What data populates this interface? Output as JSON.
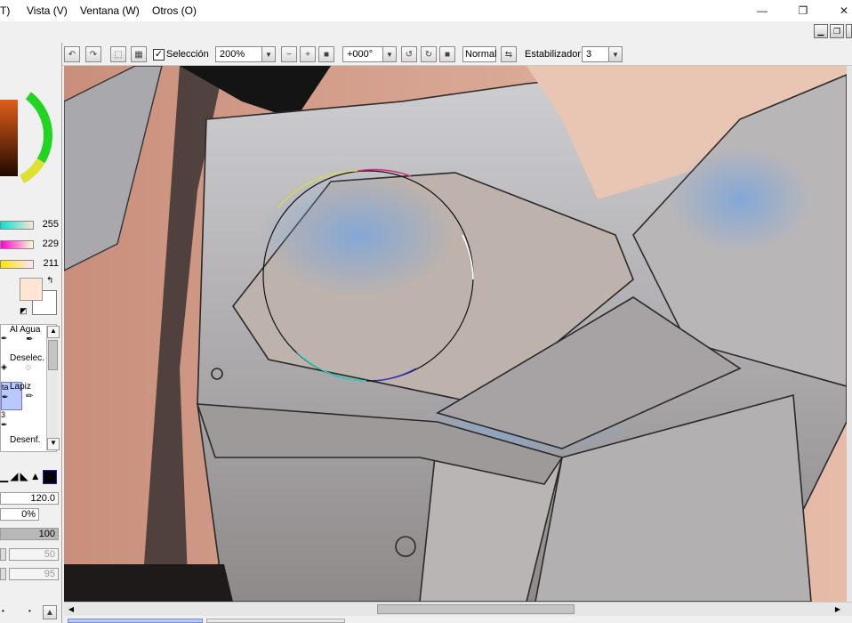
{
  "menu": {
    "items": [
      {
        "id": "menu-partial",
        "label": "T)"
      },
      {
        "id": "menu-vista",
        "label": "Vista (V)"
      },
      {
        "id": "menu-ventana",
        "label": "Ventana (W)"
      },
      {
        "id": "menu-otros",
        "label": "Otros (O)"
      }
    ]
  },
  "window": {
    "minimize": "—",
    "restore": "❐",
    "close": "✕"
  },
  "toolbar": {
    "selection_label": "Selección",
    "selection_checked": true,
    "zoom_value": "200%",
    "rotation_value": "+000°",
    "blend_mode": "Normal",
    "stabilizer_label": "Estabilizador",
    "stabilizer_value": "3"
  },
  "color_panel": {
    "slider_values": [
      "255",
      "229",
      "211"
    ],
    "slider_colors": [
      "#ffe5d3",
      "#ffe5d3",
      "#ffe5d3"
    ],
    "fg_color": "#ffe5d3",
    "bg_color": "#ffffff"
  },
  "tools": {
    "al_agua": "Al Agua",
    "deselec": "Deselec.",
    "partial_ta": "ta",
    "lapiz": "Lapiz",
    "partial_3": "3",
    "desenf": "Desenf."
  },
  "brush": {
    "size_value": "120.0",
    "density_value": "0%",
    "opacity_value": "100",
    "param_1": "50",
    "param_2": "95"
  },
  "colors": {
    "accent_selected": "#b9c8ff",
    "canvas_bg": "#d8a894"
  }
}
